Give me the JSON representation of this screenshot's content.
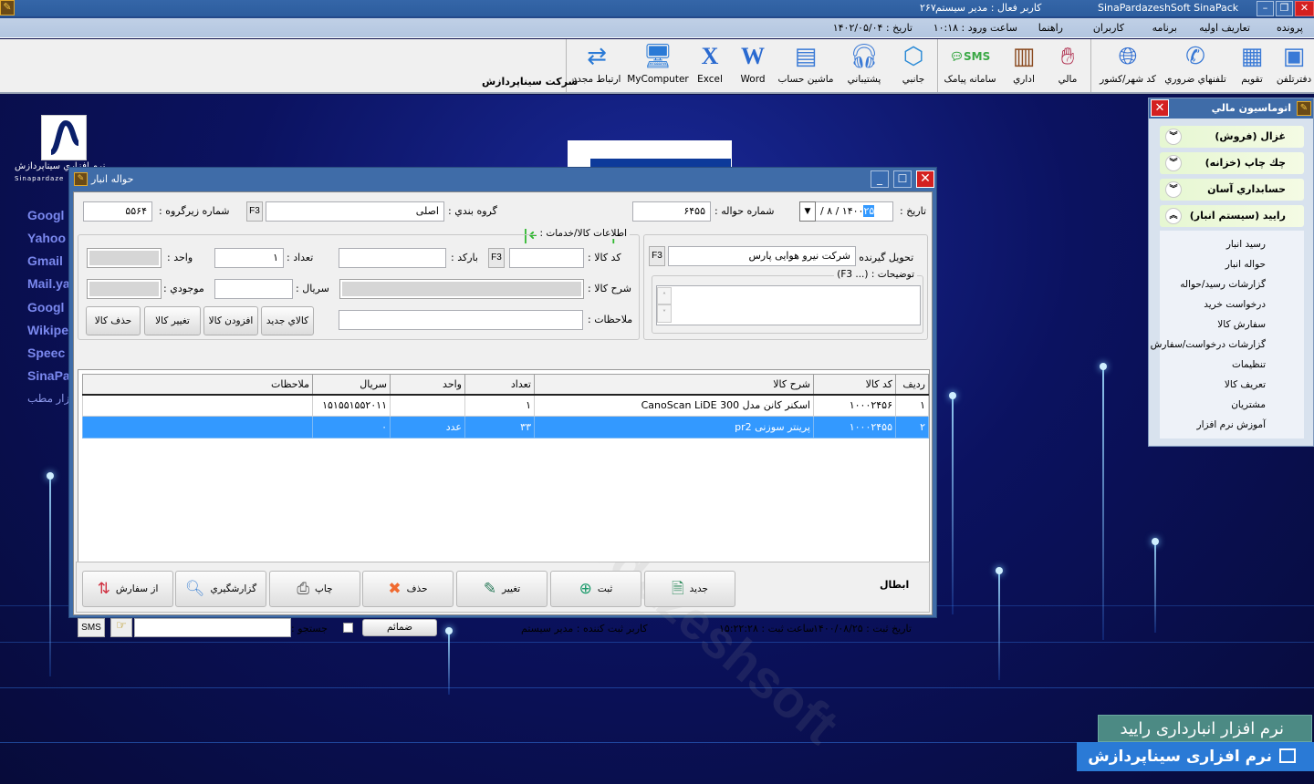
{
  "titlebar": {
    "app_title": "SinaPardazeshSoft SinaPack",
    "active_user": "کاربر فعال : مدیر سیستم",
    "code": "۲۶۷"
  },
  "menubar": {
    "items": [
      "پرونده",
      "تعاریف اولیه",
      "برنامه",
      "کاربران",
      "راهنما"
    ],
    "login_time": "ساعت ورود : ۱۰:۱۸",
    "date": "تاریخ : ۱۴۰۲/۰۵/۰۴"
  },
  "toolbar": {
    "items": [
      {
        "label": "دفترتلفن",
        "icon": "contacts-icon"
      },
      {
        "label": "تقویم",
        "icon": "calendar-icon"
      },
      {
        "label": "تلفنهاي ضروري",
        "icon": "phone-icon"
      },
      {
        "label": "کد شهر/کشور",
        "icon": "globe-icon"
      },
      {
        "label": "مالي",
        "icon": "finance-hand-icon"
      },
      {
        "label": "اداري",
        "icon": "building-icon"
      },
      {
        "label": "سامانه پیامک",
        "icon": "sms-icon"
      },
      {
        "label": "جانبي",
        "icon": "box-icon"
      },
      {
        "label": "پشتیباني",
        "icon": "headset-icon"
      },
      {
        "label": "ماشین حساب",
        "icon": "calculator-icon"
      },
      {
        "label": "Word",
        "icon": "word-icon"
      },
      {
        "label": "Excel",
        "icon": "excel-icon"
      },
      {
        "label": "MyComputer",
        "icon": "computer-icon"
      },
      {
        "label": "ارتباط مجدد",
        "icon": "reconnect-icon"
      }
    ],
    "company": "شرکت سیناپردازش"
  },
  "desktop": {
    "logo_caption": "نرم افزاري سيناپردازش",
    "logo_sub": "Sinapardaze",
    "links": [
      "Googl",
      "Yahoo",
      "Gmail",
      "Mail.ya",
      "Googl",
      "Wikipe",
      "Speec",
      "SinaPa",
      "زار مطب"
    ],
    "brand_line1": "نرم افزار انبارداری رایید",
    "brand_line2": "نرم افزاری سیناپردازش"
  },
  "sidepanel": {
    "title": "اتوماسیون مالي",
    "groups": [
      {
        "label": "غزال (فروش)",
        "expanded": false
      },
      {
        "label": "چك چاپ (خزانه)",
        "expanded": false
      },
      {
        "label": "حسابداري آسان",
        "expanded": false
      },
      {
        "label": "رايید (سیستم انبار)",
        "expanded": true
      }
    ],
    "subitems": [
      "رسید انبار",
      "حواله انبار",
      "گزارشات رسید/حواله",
      "درخواست خرید",
      "سفارش کالا",
      "گزارشات درخواست/سفارش",
      "تنظیمات",
      "تعریف کالا",
      "مشتریان",
      "آموزش نرم افزار"
    ]
  },
  "dialog": {
    "title": "حواله انبار",
    "header": {
      "date_label": "تاریخ :",
      "date_day": "۲۵",
      "date_rest": "/ ۸ / ۱۴۰۰",
      "number_label": "شماره حواله :",
      "number_value": "۶۴۵۵",
      "group_label": "گروه بندي :",
      "group_value": "اصلی",
      "subgroup_label": "شماره زيرگروه :",
      "subgroup_value": "۵۵۶۴",
      "f3": "F3"
    },
    "receiver": {
      "label": "تحویل گیرنده :",
      "value": "شرکت نیرو هوایی پارس",
      "notes_caption": "توضیحات : (... F3)",
      "notes_value": ""
    },
    "item_box": {
      "caption": "اطلاعات کالا/خدمات :",
      "code_label": "کد کالا :",
      "code_value": "",
      "barcode_label": "بارکد :",
      "barcode_value": "",
      "qty_label": "تعداد :",
      "qty_value": "۱",
      "unit_label": "واحد :",
      "desc_label": "شرح کالا :",
      "serial_label": "سریال :",
      "serial_value": "",
      "stock_label": "موجودي :",
      "remarks_label": "ملاحظات :",
      "remarks_value": "",
      "buttons": [
        "کالاي جدید",
        "افزودن کالا",
        "تغییر کالا",
        "حذف کالا"
      ]
    },
    "grid": {
      "columns": [
        "ردیف",
        "کد کالا",
        "شرح کالا",
        "تعداد",
        "واحد",
        "سریال",
        "ملاحظات"
      ],
      "rows": [
        {
          "cells": [
            "۱",
            "۱۰۰۰۲۴۵۶",
            "اسکنر کانن مدل CanoScan LiDE 300",
            "۱",
            "",
            "۱۵۱۵۵۱۵۵۲۰۱۱",
            ""
          ],
          "selected": false
        },
        {
          "cells": [
            "۲",
            "۱۰۰۰۲۴۵۵",
            "پرینتر سوزنی pr2",
            "۳۳",
            "عدد",
            "۰",
            ""
          ],
          "selected": true
        }
      ]
    },
    "actions": {
      "cancel_label": "ابطال",
      "buttons": [
        {
          "label": "جدید",
          "icon": "new-document-icon"
        },
        {
          "label": "ثبت",
          "icon": "plus-circle-icon"
        },
        {
          "label": "تغییر",
          "icon": "edit-icon"
        },
        {
          "label": "حذف",
          "icon": "delete-icon"
        },
        {
          "label": "چاپ",
          "icon": "printer-icon"
        },
        {
          "label": "گزارشگیري",
          "icon": "report-icon"
        },
        {
          "label": "از سفارش",
          "icon": "from-order-icon"
        }
      ]
    },
    "status": {
      "reg_date": "تاریخ ثبت : ۱۴۰۰/۰۸/۲۵",
      "reg_time": "ساعت ثبت : ۱۵:۲۲:۲۸",
      "reg_user": "کاربر ثبت کننده : مدیر سیستم",
      "attachments": "ضمائم",
      "search_label": "جستجو :",
      "search_checked": false,
      "search_value": "",
      "sms": "SMS"
    },
    "watermark": "sinapardazeshsoft"
  }
}
